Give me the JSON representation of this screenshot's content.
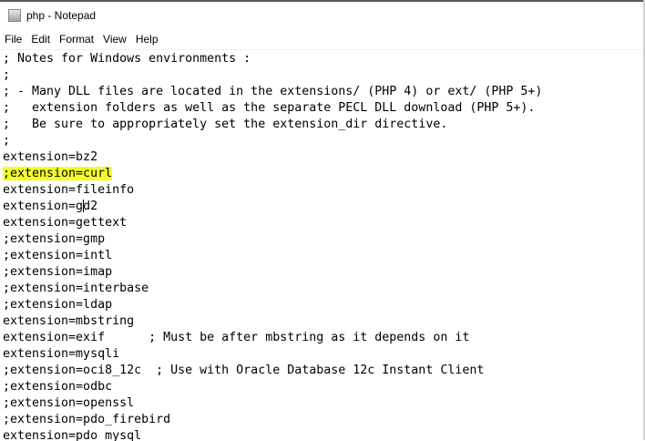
{
  "window": {
    "title": "php - Notepad",
    "icon": "notepad-icon"
  },
  "menu": [
    "File",
    "Edit",
    "Format",
    "View",
    "Help"
  ],
  "editor": {
    "lines": [
      "; Notes for Windows environments :",
      ";",
      "; - Many DLL files are located in the extensions/ (PHP 4) or ext/ (PHP 5+)",
      ";   extension folders as well as the separate PECL DLL download (PHP 5+).",
      ";   Be sure to appropriately set the extension_dir directive.",
      ";",
      "extension=bz2",
      ";extension=curl",
      "extension=fileinfo",
      "extension=gd2",
      "extension=gettext",
      ";extension=gmp",
      ";extension=intl",
      ";extension=imap",
      ";extension=interbase",
      ";extension=ldap",
      "extension=mbstring",
      "extension=exif      ; Must be after mbstring as it depends on it",
      "extension=mysqli",
      ";extension=oci8_12c  ; Use with Oracle Database 12c Instant Client",
      ";extension=odbc",
      ";extension=openssl",
      ";extension=pdo_firebird",
      "extension=pdo_mysql"
    ],
    "highlighted_line": ";extension=curl",
    "highlight_color": "#f4ff2a"
  }
}
